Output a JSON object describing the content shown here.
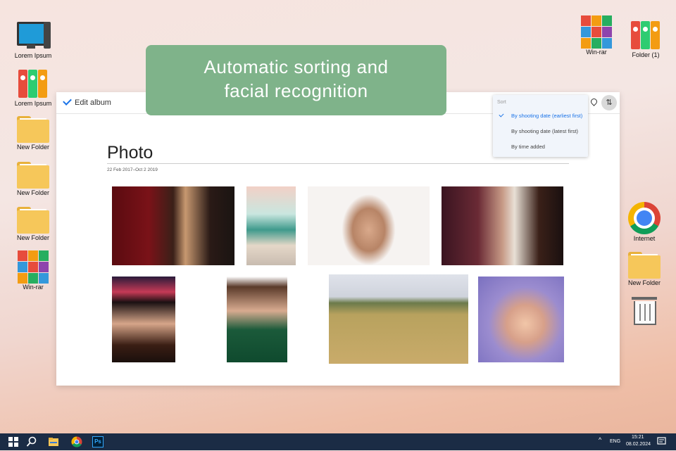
{
  "desktop_left": [
    {
      "label": "Lorem Ipsum",
      "icon": "computer-icon"
    },
    {
      "label": "Lorem Ipsum",
      "icon": "binders-icon"
    },
    {
      "label": "New Folder",
      "icon": "folder-icon"
    },
    {
      "label": "New Folder",
      "icon": "folder-icon"
    },
    {
      "label": "New Folder",
      "icon": "folder-icon"
    },
    {
      "label": "Win-rar",
      "icon": "winrar-icon"
    }
  ],
  "desktop_right": [
    {
      "label": "Win-rar",
      "icon": "winrar-icon"
    },
    {
      "label": "Folder (1)",
      "icon": "binders-icon"
    },
    {
      "label": "Internet",
      "icon": "chrome-icon"
    },
    {
      "label": "New Folder",
      "icon": "folder-icon"
    },
    {
      "label": "",
      "icon": "trash-icon"
    }
  ],
  "banner": {
    "line1": "Automatic sorting and",
    "line2": "facial recognition"
  },
  "album": {
    "edit_label": "Edit album",
    "title": "Photo",
    "date_range": "22 Feb 2017–Oct 2 2019"
  },
  "sort_menu": {
    "header": "Sort",
    "items": [
      {
        "label": "By shooting date (earliest first)",
        "selected": true
      },
      {
        "label": "By shooting date (latest first)",
        "selected": false
      },
      {
        "label": "By time added",
        "selected": false
      }
    ]
  },
  "photos_count_row1": 4,
  "photos_count_row2": 4,
  "taskbar": {
    "lang": "ENG",
    "time": "15:21",
    "date": "08.02.2024",
    "apps": [
      "start-icon",
      "search-icon",
      "file-explorer-icon",
      "chrome-icon",
      "photoshop-icon"
    ],
    "ps_label": "Ps"
  },
  "colors": {
    "accent": "#1a73e8",
    "banner": "#7fb38a",
    "taskbar": "#1b2c45"
  }
}
